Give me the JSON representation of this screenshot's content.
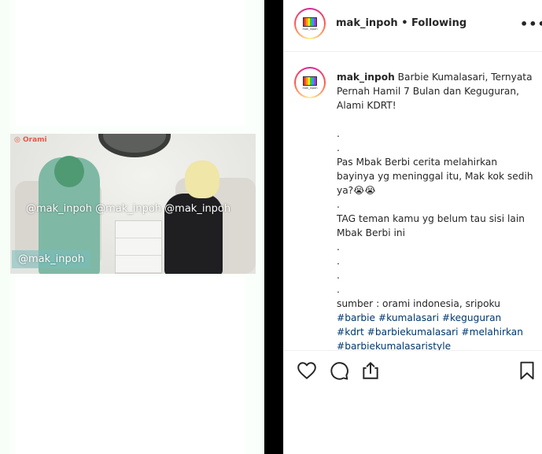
{
  "media": {
    "brand": "◎ Orami",
    "watermark_row": "@mak_inpoh @mak_inpoh @mak_inpoh",
    "watermark_box": "@mak_inpoh"
  },
  "header": {
    "username": "mak_inpoh",
    "separator": "•",
    "follow_status": "Following",
    "more": "•••"
  },
  "post": {
    "username": "mak_inpoh",
    "title": "Barbie Kumalasari, Ternyata Pernah Hamil 7 Bulan dan Keguguran, Alami KDRT!",
    "lines": [
      ".",
      ".",
      "Pas Mbak Berbi cerita melahirkan bayinya yg meninggal itu, Mak kok sedih ya?😭😭",
      ".",
      "TAG teman kamu yg belum tau sisi lain Mbak Berbi ini",
      ".",
      ".",
      ".",
      ".",
      "sumber : orami indonesia, sripoku"
    ],
    "hashtags_1": "#barbie #kumalasari #keguguran",
    "hashtags_2": "#kdrt #barbiekumalasari #melahirkan",
    "hashtags_3": "#barbiekumalasaristyle"
  },
  "icons": {
    "like": "heart-icon",
    "comment": "comment-icon",
    "share": "share-icon",
    "save": "bookmark-icon"
  },
  "colors": {
    "divider": "#000000",
    "hashtag": "#00376b",
    "text": "#262626"
  }
}
